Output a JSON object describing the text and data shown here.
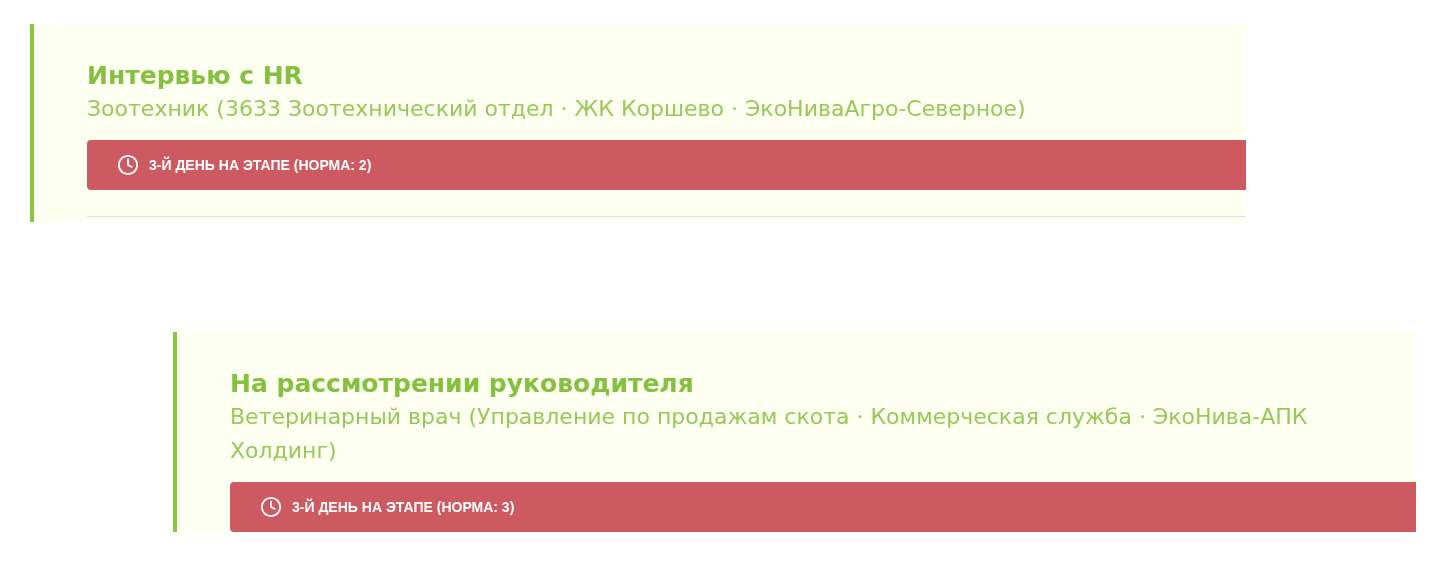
{
  "cards": [
    {
      "title": "Интервью с HR",
      "subtitle": "Зоотехник (3633 Зоотехнический отдел · ЖК Коршево · ЭкоНиваАгро-Северное)",
      "alert": "3-Й ДЕНЬ НА ЭТАПЕ (НОРМА: 2)",
      "divider": true
    },
    {
      "title": "На рассмотрении руководителя",
      "subtitle": "Ветеринарный врач (Управление по продажам скота · Коммерческая служба · ЭкоНива-АПК Холдинг)",
      "alert": "3-Й ДЕНЬ НА ЭТАПЕ (НОРМА: 3)",
      "divider": false
    }
  ]
}
